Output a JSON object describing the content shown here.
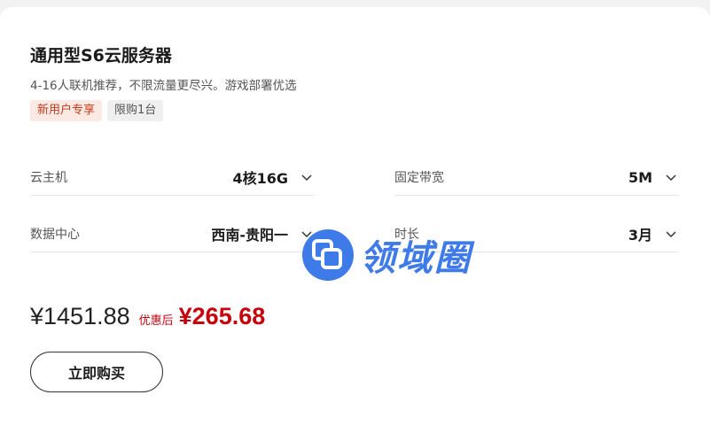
{
  "product": {
    "title": "通用型S6云服务器",
    "subtitle": "4-16人联机推荐，不限流量更尽兴。游戏部署优选",
    "badges": [
      "新用户专享",
      "限购1台"
    ]
  },
  "options": [
    {
      "label": "云主机",
      "value": "4核16G",
      "icon": "chevron-down-icon"
    },
    {
      "label": "固定带宽",
      "value": "5M",
      "icon": "chevron-down-icon"
    },
    {
      "label": "数据中心",
      "value": "西南-贵阳一",
      "icon": "chevron-down-icon"
    },
    {
      "label": "时长",
      "value": "3月",
      "icon": "chevron-down-icon"
    }
  ],
  "pricing": {
    "original_price": "¥1451.88",
    "after_discount_label": "优惠后",
    "sale_price": "¥265.68"
  },
  "buy_button": {
    "label": "立即购买"
  },
  "watermark": {
    "text": "领域圈"
  },
  "colors": {
    "accent_red": "#c7000b",
    "badge_new_bg": "#fbeae3",
    "badge_new_text": "#c5391c",
    "watermark_blue": "#2f6fe8"
  }
}
